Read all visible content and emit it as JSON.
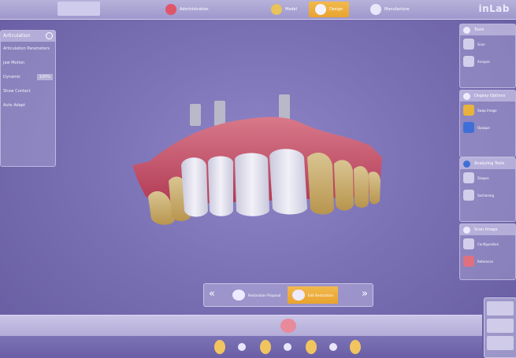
{
  "brand": "inLab",
  "phases": [
    {
      "label": "Administration",
      "active": false
    },
    {
      "label": "Model",
      "active": false
    },
    {
      "label": "Design",
      "active": true
    },
    {
      "label": "Manufacture",
      "active": false
    }
  ],
  "left_panel": {
    "title": "Articulation",
    "rows": [
      "Articulation Parameters",
      "Jaw Motion",
      "Dynamic",
      "Show Contact",
      "Auto Adapt"
    ],
    "toggle_value": "100%"
  },
  "right_toolbar": {
    "groups": [
      {
        "title": "Tools",
        "items": [
          "Scan",
          "Analyze"
        ]
      },
      {
        "title": "Display Options",
        "items": [
          "Swap Image",
          "Opaque"
        ]
      },
      {
        "title": "Analyzing Tools",
        "items": [
          "Shapes",
          "Sectioning"
        ]
      },
      {
        "title": "Scan Image",
        "items": [
          "Configuration",
          "Reference"
        ]
      }
    ]
  },
  "step_nav": {
    "steps": [
      {
        "label": "Restoration Proposal",
        "active": false
      },
      {
        "label": "Edit Restoration",
        "active": true
      }
    ]
  },
  "colors": {
    "accent": "#f2b94d",
    "background": "#7a70b4",
    "gingiva": "#c9556a",
    "crown": "#e6e5f0"
  }
}
